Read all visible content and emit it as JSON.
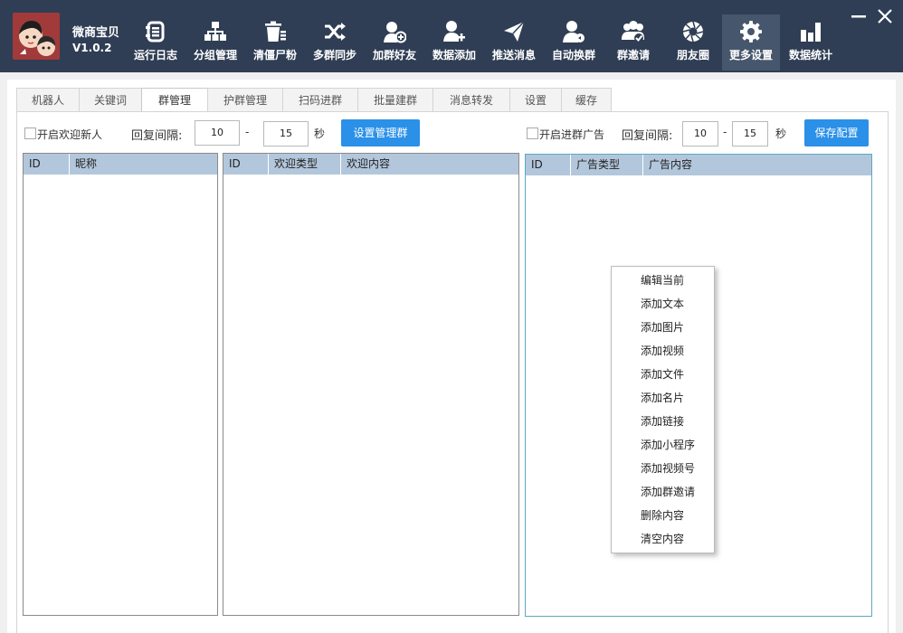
{
  "app": {
    "name": "微商宝贝",
    "version": "V1.0.2"
  },
  "nav": [
    {
      "label": "运行日志",
      "icon": "log-icon"
    },
    {
      "label": "分组管理",
      "icon": "org-chart-icon"
    },
    {
      "label": "清僵尸粉",
      "icon": "trash-icon"
    },
    {
      "label": "多群同步",
      "icon": "shuffle-icon"
    },
    {
      "label": "加群好友",
      "icon": "add-friend-icon"
    },
    {
      "label": "数据添加",
      "icon": "add-user-icon"
    },
    {
      "label": "推送消息",
      "icon": "send-icon"
    },
    {
      "label": "自动换群",
      "icon": "user-switch-icon"
    },
    {
      "label": "群邀请",
      "icon": "group-invite-icon"
    },
    {
      "label": "朋友圈",
      "icon": "aperture-icon"
    },
    {
      "label": "更多设置",
      "icon": "gear-icon"
    },
    {
      "label": "数据统计",
      "icon": "bar-chart-icon"
    }
  ],
  "active_nav": "更多设置",
  "tabs": [
    "机器人",
    "关键词",
    "群管理",
    "护群管理",
    "扫码进群",
    "批量建群",
    "消息转发",
    "设置",
    "缓存"
  ],
  "active_tab": "群管理",
  "welcome": {
    "enable_label": "开启欢迎新人",
    "interval_label": "回复间隔:",
    "interval_min": "10",
    "separator": "-",
    "interval_max": "15",
    "unit": "秒",
    "set_admin_button": "设置管理群"
  },
  "ads": {
    "enable_label": "开启进群广告",
    "interval_label": "回复间隔:",
    "interval_min": "10",
    "separator": "-",
    "interval_max": "15",
    "unit": "秒",
    "save_button": "保存配置"
  },
  "tables": {
    "groups": {
      "columns": [
        "ID",
        "昵称"
      ]
    },
    "welcome": {
      "columns": [
        "ID",
        "欢迎类型",
        "欢迎内容"
      ]
    },
    "ads": {
      "columns": [
        "ID",
        "广告类型",
        "广告内容"
      ]
    }
  },
  "context_menu": [
    "编辑当前",
    "添加文本",
    "添加图片",
    "添加视频",
    "添加文件",
    "添加名片",
    "添加链接",
    "添加小程序",
    "添加视频号",
    "添加群邀请",
    "删除内容",
    "清空内容"
  ],
  "colors": {
    "header_bg": "#2f3e54",
    "accent": "#2b90e8",
    "table_header": "#b3c7dc"
  }
}
